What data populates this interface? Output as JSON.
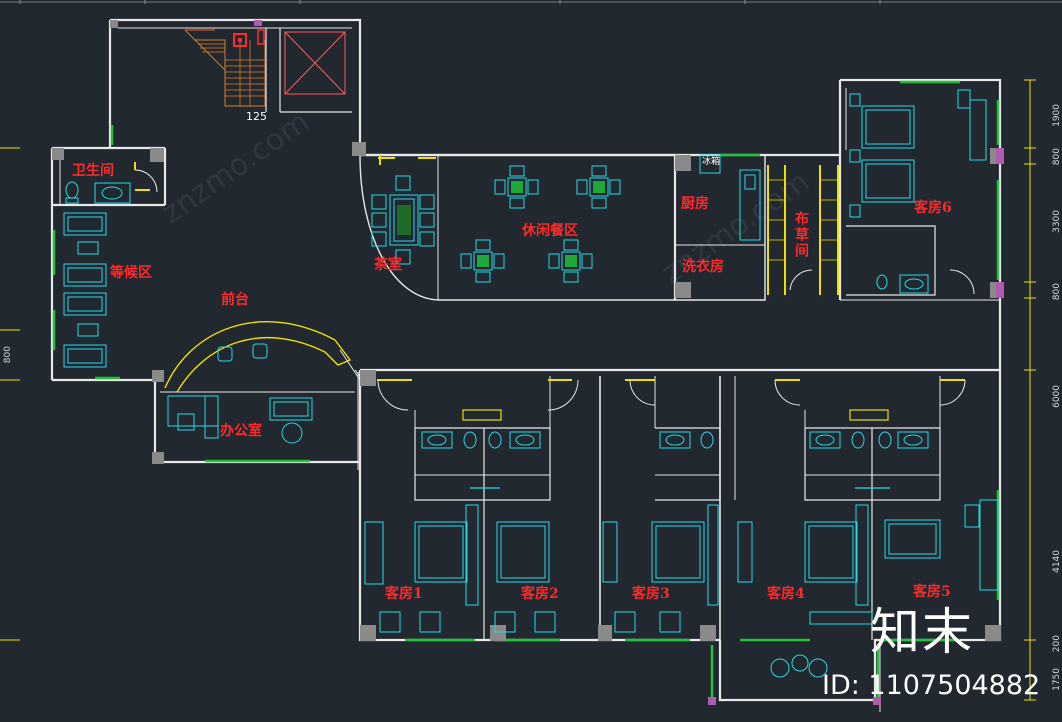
{
  "plan": {
    "rooms": {
      "restroom": "卫生间",
      "waiting_area": "等候区",
      "front_desk": "前台",
      "office": "办公室",
      "tea_room": "茶室",
      "leisure_dining": "休闲餐区",
      "kitchen": "厨房",
      "laundry": "洗衣房",
      "linen_room": "布草间",
      "guest_room_6": "客房6",
      "guest_room_1": "客房1",
      "guest_room_2": "客房2",
      "guest_room_3": "客房3",
      "guest_room_4": "客房4",
      "guest_room_5": "客房5"
    },
    "stair_label": "125",
    "fridge_label": "冰箱",
    "left_dimension": "800",
    "right_dimensions": [
      "1900",
      "800",
      "3300",
      "800",
      "6000",
      "4140",
      "200",
      "1750"
    ]
  },
  "watermark": {
    "logo": "知末",
    "id_text": "ID: 1107504882",
    "diagonal": "znzmo.com"
  },
  "colors": {
    "background": "#212830",
    "wall": "#e8e8e8",
    "furniture": "#27d9e6",
    "label": "#ff2a2a",
    "stair": "#e07b1f",
    "front_desk_arc": "#f0e000",
    "window": "#23c23a",
    "door_frame": "#f0e000",
    "column": "#8a8a8a",
    "column_accent": "#b05ab0"
  }
}
